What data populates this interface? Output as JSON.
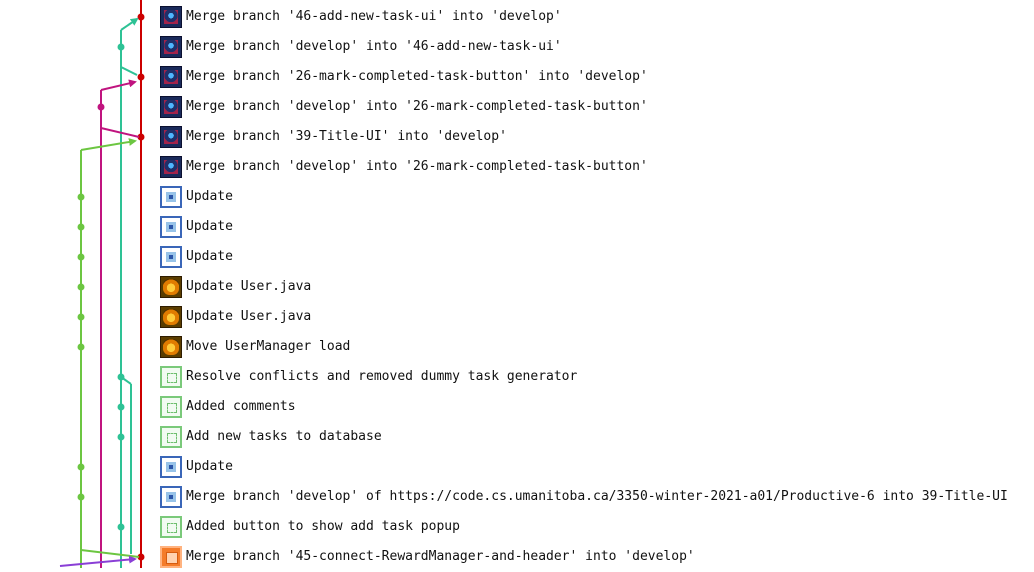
{
  "colors": {
    "branch_main": "#cc0000",
    "branch_teal": "#2ec295",
    "branch_magenta": "#c0147f",
    "branch_green": "#6cc641",
    "branch_purple": "#8a3fd6"
  },
  "commits": [
    {
      "message": "Merge branch '46-add-new-task-ui' into 'develop'",
      "avatar": "dark-avatar"
    },
    {
      "message": "Merge branch 'develop' into '46-add-new-task-ui'",
      "avatar": "dark-avatar"
    },
    {
      "message": "Merge branch '26-mark-completed-task-button' into 'develop'",
      "avatar": "dark-avatar"
    },
    {
      "message": "Merge branch 'develop' into '26-mark-completed-task-button'",
      "avatar": "dark-avatar"
    },
    {
      "message": "Merge branch '39-Title-UI' into 'develop'",
      "avatar": "dark-avatar"
    },
    {
      "message": "Merge branch 'develop' into '26-mark-completed-task-button'",
      "avatar": "dark-avatar"
    },
    {
      "message": "Update",
      "avatar": "blue-avatar"
    },
    {
      "message": "Update",
      "avatar": "blue-avatar"
    },
    {
      "message": "Update",
      "avatar": "blue-avatar"
    },
    {
      "message": "Update User.java",
      "avatar": "fox-avatar"
    },
    {
      "message": "Update User.java",
      "avatar": "fox-avatar"
    },
    {
      "message": "Move UserManager load",
      "avatar": "fox-avatar"
    },
    {
      "message": "Resolve conflicts and removed dummy task generator",
      "avatar": "green-avatar"
    },
    {
      "message": "Added comments",
      "avatar": "green-avatar"
    },
    {
      "message": "Add new tasks to database",
      "avatar": "green-avatar"
    },
    {
      "message": "Update",
      "avatar": "blue-avatar"
    },
    {
      "message": "Merge branch 'develop' of https://code.cs.umanitoba.ca/3350-winter-2021-a01/Productive-6 into 39-Title-UI",
      "avatar": "blue-avatar"
    },
    {
      "message": "Added button to show add task popup",
      "avatar": "green-avatar"
    },
    {
      "message": "Merge branch '45-connect-RewardManager-and-header' into 'develop'",
      "avatar": "orange-avatar"
    }
  ]
}
